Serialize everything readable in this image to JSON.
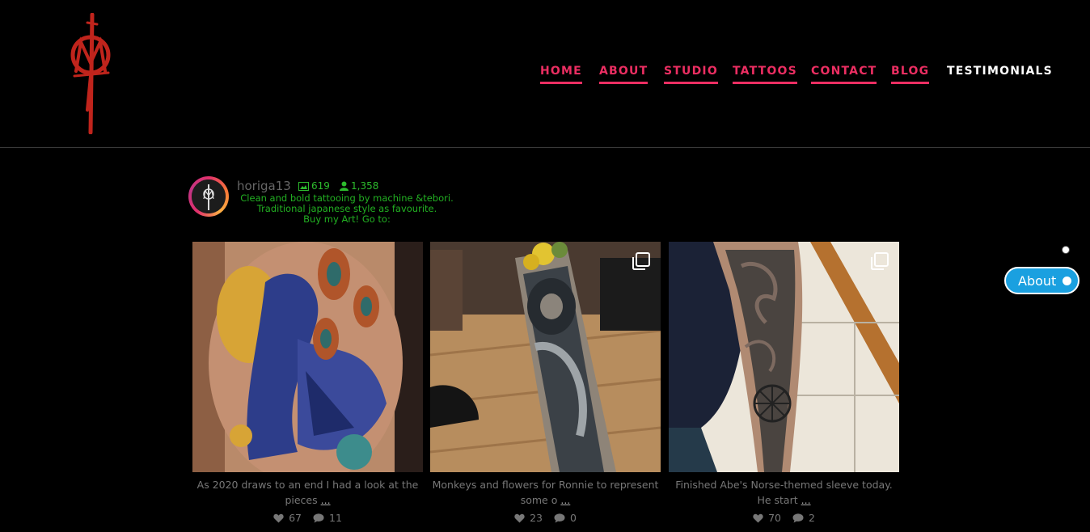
{
  "nav": {
    "home": "HOME",
    "about": "ABOUT",
    "studio": "STUDIO",
    "tattoos": "TATTOOS",
    "contact": "CONTACT",
    "blog": "BLOG",
    "testimonials": "TESTIMONIALS"
  },
  "profile": {
    "username": "horiga13",
    "posts_count": "619",
    "followers_count": "1,358",
    "bio": [
      "Clean and bold tattooing by machine &tebori.",
      "Traditional japanese style as favourite.",
      "Buy my Art! Go to:"
    ]
  },
  "posts": [
    {
      "caption_line1": "As 2020 draws to an end I had a look at the",
      "caption_line2": "pieces",
      "more": "...",
      "likes": "67",
      "comments": "11",
      "icon": "peacock-tattoo-image"
    },
    {
      "caption_line1": "Monkeys and flowers for Ronnie to represent",
      "caption_line2": "some o",
      "more": "...",
      "likes": "23",
      "comments": "0",
      "icon": "monkey-tattoo-image"
    },
    {
      "caption_line1": "Finished Abe's Norse-themed sleeve today.",
      "caption_line2": "He start",
      "more": "...",
      "likes": "70",
      "comments": "2",
      "icon": "norse-sleeve-image"
    }
  ],
  "about_widget": {
    "label": "About"
  },
  "colors": {
    "nav_accent": "#ec2e62",
    "bio_green": "#22b022",
    "about_blue": "#1aa0e0",
    "logo_red": "#c0241c"
  }
}
